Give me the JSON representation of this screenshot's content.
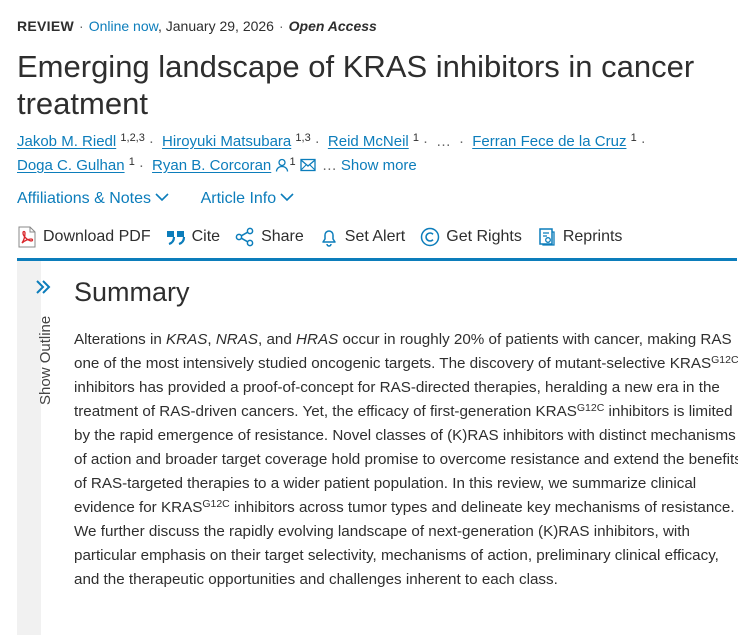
{
  "header": {
    "type_label": "REVIEW",
    "online_label": "Online now",
    "date": "January 29, 2026",
    "access": "Open Access"
  },
  "title": "Emerging landscape of KRAS inhibitors in cancer treatment",
  "authors": [
    {
      "name": "Jakob M. Riedl",
      "sup": "1,2,3"
    },
    {
      "name": "Hiroyuki Matsubara",
      "sup": "1,3"
    },
    {
      "name": "Reid McNeil",
      "sup": "1"
    },
    {
      "name": "Ferran Fece de la Cruz",
      "sup": "1"
    },
    {
      "name": "Doga C. Gulhan",
      "sup": "1"
    },
    {
      "name": "Ryan B. Corcoran",
      "sup": "1"
    }
  ],
  "authors_ellipsis": "…",
  "show_more": "Show more",
  "info_links": {
    "affiliations": "Affiliations & Notes",
    "article_info": "Article Info"
  },
  "actions": {
    "download": "Download PDF",
    "cite": "Cite",
    "share": "Share",
    "alert": "Set Alert",
    "rights": "Get Rights",
    "reprints": "Reprints"
  },
  "outline_label": "Show Outline",
  "section_title": "Summary",
  "abstract": {
    "s1a": "Alterations in ",
    "kras": "KRAS",
    "s1b": ", ",
    "nras": "NRAS",
    "s1c": ", and ",
    "hras": "HRAS",
    "s1d": " occur in roughly 20% of patients with cancer, making RAS one of the most intensively studied oncogenic targets. The discovery of mutant-selective ",
    "kras_gene": "KRAS",
    "g12c": "G12C",
    "s2": " inhibitors has provided a proof-of-concept for RAS-directed therapies, heralding a new era in the treatment of RAS-driven cancers. Yet, the efficacy of first-generation ",
    "s3": " inhibitors is limited by the rapid emergence of resistance. Novel classes of (K)RAS inhibitors with distinct mechanisms of action and broader target coverage hold promise to overcome resistance and extend the benefits of RAS-targeted therapies to a wider patient population. In this review, we summarize clinical evidence for ",
    "s4": " inhibitors across tumor types and delineate key mechanisms of resistance. We further discuss the rapidly evolving landscape of next-generation (K)RAS inhibitors, with particular emphasis on their target selectivity, mechanisms of action, preliminary clinical efficacy, and the therapeutic opportunities and challenges inherent to each class."
  },
  "colors": {
    "link": "#0c7dbb",
    "text": "#2e2e2e",
    "rule": "#0c7dbb",
    "pdf": "#d9262b"
  }
}
